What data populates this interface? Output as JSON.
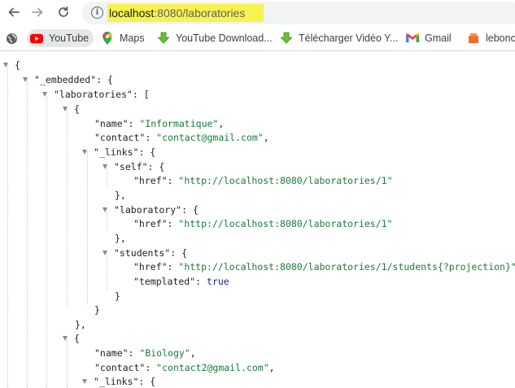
{
  "browser": {
    "url_host": "localhost",
    "url_rest": ":8080/laboratories",
    "icons": {
      "back": "arrow-left-icon",
      "forward": "arrow-right-icon",
      "reload": "reload-icon",
      "info": "info-icon"
    },
    "highlight_color": "#f7f24d"
  },
  "bookmarks": [
    {
      "label": "",
      "icon": "globe-icon"
    },
    {
      "label": "YouTube",
      "icon": "youtube-icon"
    },
    {
      "label": "Maps",
      "icon": "maps-pin-icon"
    },
    {
      "label": "YouTube Download...",
      "icon": "download-arrow-icon"
    },
    {
      "label": "Télécharger Vidéo Y...",
      "icon": "download-arrow-icon"
    },
    {
      "label": "Gmail",
      "icon": "gmail-icon"
    },
    {
      "label": "leboncc",
      "icon": "leboncoin-icon"
    }
  ],
  "json": {
    "open_brace": "{",
    "embedded_key": "\"_embedded\"",
    "embedded_open": ": {",
    "laboratories_key": "\"laboratories\"",
    "laboratories_open": ": [",
    "item_open": "{",
    "item_close": "},",
    "name_key": "\"name\"",
    "contact_key": "\"contact\"",
    "links_key": "\"_links\"",
    "self_key": "\"self\"",
    "laboratory_key": "\"laboratory\"",
    "students_key": "\"students\"",
    "href_key": "\"href\"",
    "templated_key": "\"templated\"",
    "obj_open": ": {",
    "obj_close": "},",
    "close": "}",
    "sep": ": ",
    "comma": ",",
    "lab1": {
      "name": "\"Informatique\"",
      "contact": "\"contact@gmail.com\"",
      "self_href": "\"http://localhost:8080/laboratories/1\"",
      "laboratory_href": "\"http://localhost:8080/laboratories/1\"",
      "students_href": "\"http://localhost:8080/laboratories/1/students{?projection}\"",
      "templated": "true"
    },
    "lab2": {
      "name": "\"Biology\"",
      "contact": "\"contact2@gmail.com\""
    }
  }
}
